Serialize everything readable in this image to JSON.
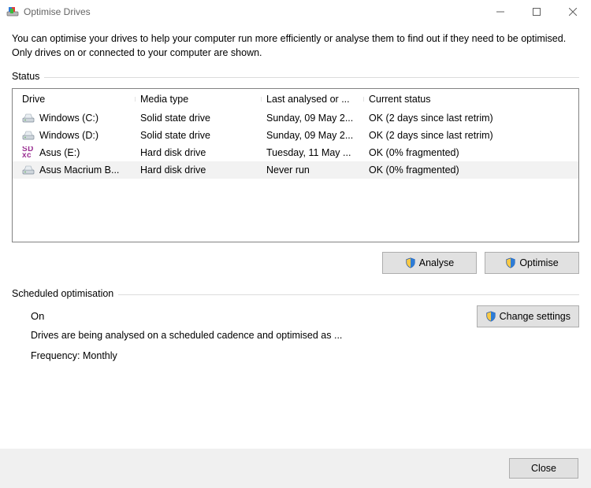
{
  "window": {
    "title": "Optimise Drives"
  },
  "intro": "You can optimise your drives to help your computer run more efficiently or analyse them to find out if they need to be optimised. Only drives on or connected to your computer are shown.",
  "status_label": "Status",
  "columns": {
    "drive": "Drive",
    "media": "Media type",
    "last": "Last analysed or ...",
    "status": "Current status"
  },
  "drives": [
    {
      "icon": "hdd",
      "name": "Windows (C:)",
      "media": "Solid state drive",
      "last": "Sunday, 09 May 2...",
      "status": "OK (2 days since last retrim)",
      "selected": false
    },
    {
      "icon": "hdd",
      "name": "Windows (D:)",
      "media": "Solid state drive",
      "last": "Sunday, 09 May 2...",
      "status": "OK (2 days since last retrim)",
      "selected": false
    },
    {
      "icon": "sd",
      "name": "Asus (E:)",
      "media": "Hard disk drive",
      "last": "Tuesday, 11 May ...",
      "status": "OK (0% fragmented)",
      "selected": false
    },
    {
      "icon": "hdd",
      "name": "Asus Macrium B...",
      "media": "Hard disk drive",
      "last": "Never run",
      "status": "OK (0% fragmented)",
      "selected": true
    }
  ],
  "buttons": {
    "analyse": "Analyse",
    "optimise": "Optimise",
    "change_settings": "Change settings",
    "close": "Close"
  },
  "scheduled": {
    "label": "Scheduled optimisation",
    "state": "On",
    "desc": "Drives are being analysed on a scheduled cadence and optimised as ...",
    "frequency": "Frequency: Monthly"
  }
}
